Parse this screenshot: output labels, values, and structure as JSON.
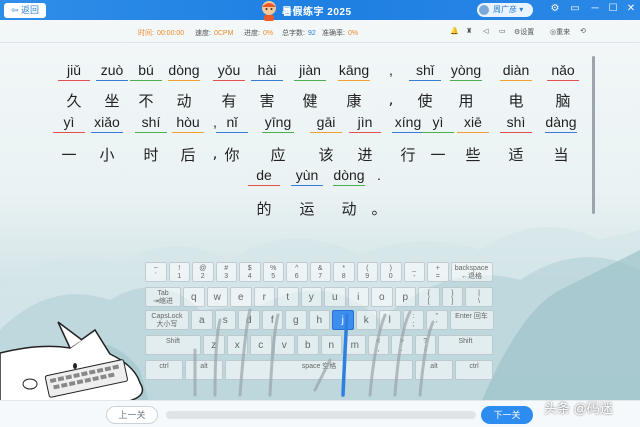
{
  "titlebar": {
    "back": "返回",
    "title": "暑假练字 2025",
    "user": "周广彦",
    "controls": [
      "⚙",
      "▭",
      "─",
      "☐",
      "✕"
    ]
  },
  "stats": {
    "time_label": "时间:",
    "time_value": "00:00:00",
    "speed_label": "速度:",
    "speed_value": "0CPM",
    "progress_label": "进度:",
    "progress_value": "0%",
    "total_label": "总字数:",
    "total_value": "92",
    "accuracy_label": "准确率:",
    "accuracy_value": "0%"
  },
  "tools": [
    "🔔",
    "♜",
    "◁",
    "▭",
    "⚙设置",
    "◎重来",
    "⟲"
  ],
  "lesson": {
    "rows": [
      {
        "pinyin": [
          "jiǔ",
          "zuò",
          "bú",
          "dòng",
          "yǒu",
          "hài",
          "jiàn",
          "kāng",
          ",",
          "shǐ",
          "yòng",
          "diàn",
          "nǎo"
        ],
        "hanzi": [
          "久",
          "坐",
          "不",
          "动",
          "有",
          "害",
          "健",
          "康",
          ",",
          "使",
          "用",
          "电",
          "脑"
        ]
      },
      {
        "pinyin": [
          "yì",
          "xiǎo",
          "shí",
          "hòu",
          ",",
          "nǐ",
          "yīng",
          "gāi",
          "jìn",
          "xíng",
          "yì",
          "xiē",
          "shì",
          "dàng"
        ],
        "hanzi": [
          "一",
          "小",
          "时",
          "后",
          ",",
          "你",
          "应",
          "该",
          "进",
          "行",
          "一",
          "些",
          "适",
          "当"
        ]
      },
      {
        "pinyin": [
          "de",
          "yùn",
          "dòng",
          "."
        ],
        "hanzi": [
          "的",
          "运",
          "动",
          "。"
        ]
      }
    ]
  },
  "keyboard": {
    "row1": [
      "~\n`",
      "!\n1",
      "@\n2",
      "#\n3",
      "$\n4",
      "%\n5",
      "^\n6",
      "&\n7",
      "*\n8",
      "(\n9",
      ")\n0",
      "_\n-",
      "+\n=",
      "backspace\n←退格"
    ],
    "row2": [
      "Tab\n⇥缩进",
      "q",
      "w",
      "e",
      "r",
      "t",
      "y",
      "u",
      "i",
      "o",
      "p",
      "{\n[",
      "}\n]",
      "|\n\\"
    ],
    "row3": [
      "CapsLock\n大小写",
      "a",
      "s",
      "d",
      "f",
      "g",
      "h",
      "j",
      "k",
      "l",
      ":\n;",
      "\"\n'",
      "Enter 回车"
    ],
    "row4": [
      "Shift",
      "z",
      "x",
      "c",
      "v",
      "b",
      "n",
      "m",
      "<\n,",
      ">\n.",
      "?\n/",
      "Shift"
    ],
    "row5": [
      "ctrl",
      "alt",
      "space 空格",
      "alt",
      "ctrl"
    ],
    "highlight": "j"
  },
  "footer": {
    "prev": "上一关",
    "next": "下一关",
    "progress": 0,
    "watermark": "头条 @码迷"
  },
  "colors": {
    "accent": "#2d8cf0",
    "stat_orange": "#f08a2a",
    "underline_red": "#e0524a",
    "underline_blue": "#3a7bd5",
    "underline_green": "#4caf50",
    "underline_orange": "#f0a030"
  }
}
